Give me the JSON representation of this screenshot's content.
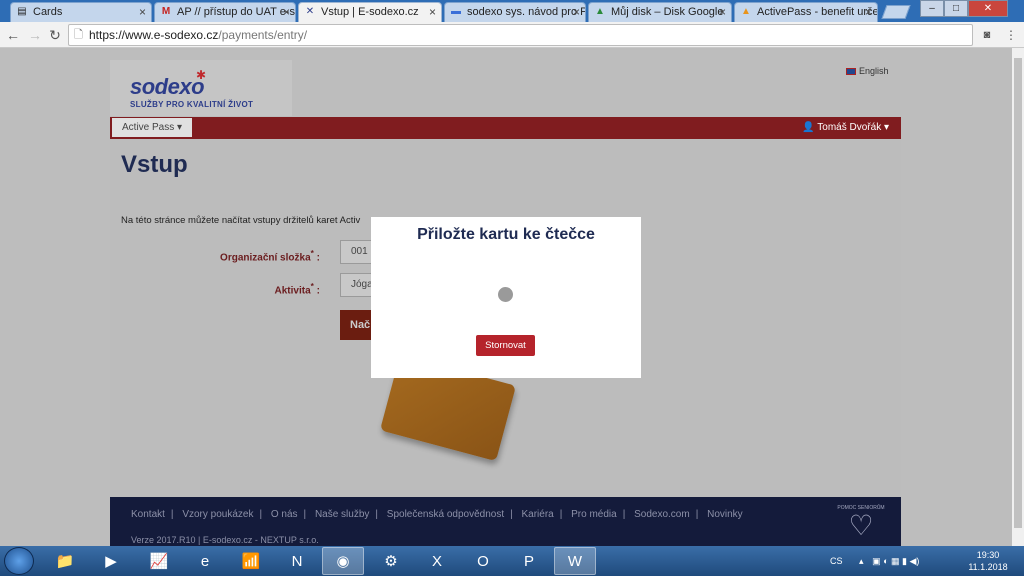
{
  "browser": {
    "tabs": [
      {
        "title": "Cards",
        "icon": "document-icon",
        "active": false
      },
      {
        "title": "AP // přístup do UAT e-s",
        "icon": "gmail-icon",
        "active": false
      },
      {
        "title": "Vstup | E-sodexo.cz",
        "icon": "sodexo-icon",
        "active": true
      },
      {
        "title": "sodexo sys. návod pro P",
        "icon": "docs-icon",
        "active": false
      },
      {
        "title": "Můj disk – Disk Google",
        "icon": "drive-icon",
        "active": false
      },
      {
        "title": "ActivePass - benefit urče",
        "icon": "activepass-icon",
        "active": false
      }
    ],
    "url_host": "https://www.e-sodexo.cz",
    "url_path": "/payments/entry/"
  },
  "site": {
    "logo": "sodexo",
    "tagline": "SLUŽBY PRO KVALITNÍ ŽIVOT",
    "language": "English",
    "nav_dropdown": "Active Pass",
    "user": "Tomáš Dvořák"
  },
  "page": {
    "title": "Vstup",
    "intro": "Na této stránce můžete načítat vstupy držitelů karet Activ",
    "field1_label": "Organizační složka",
    "field1_value": "001",
    "field2_label": "Aktivita",
    "field2_value": "Jóga",
    "load_button": "Nač"
  },
  "modal": {
    "title": "Přiložte kartu ke čtečce",
    "cancel": "Stornovat"
  },
  "footer": {
    "links": [
      "Kontakt",
      "Vzory poukázek",
      "O nás",
      "Naše služby",
      "Společenská odpovědnost",
      "Kariéra",
      "Pro média",
      "Sodexo.com",
      "Novinky"
    ],
    "version": "Verze 2017.R10 | E-sodexo.cz - NEXTUP s.r.o.",
    "badge": "POMOC SENIORŮM"
  },
  "taskbar": {
    "lang": "CS",
    "time": "19:30",
    "date": "11.1.2018"
  }
}
